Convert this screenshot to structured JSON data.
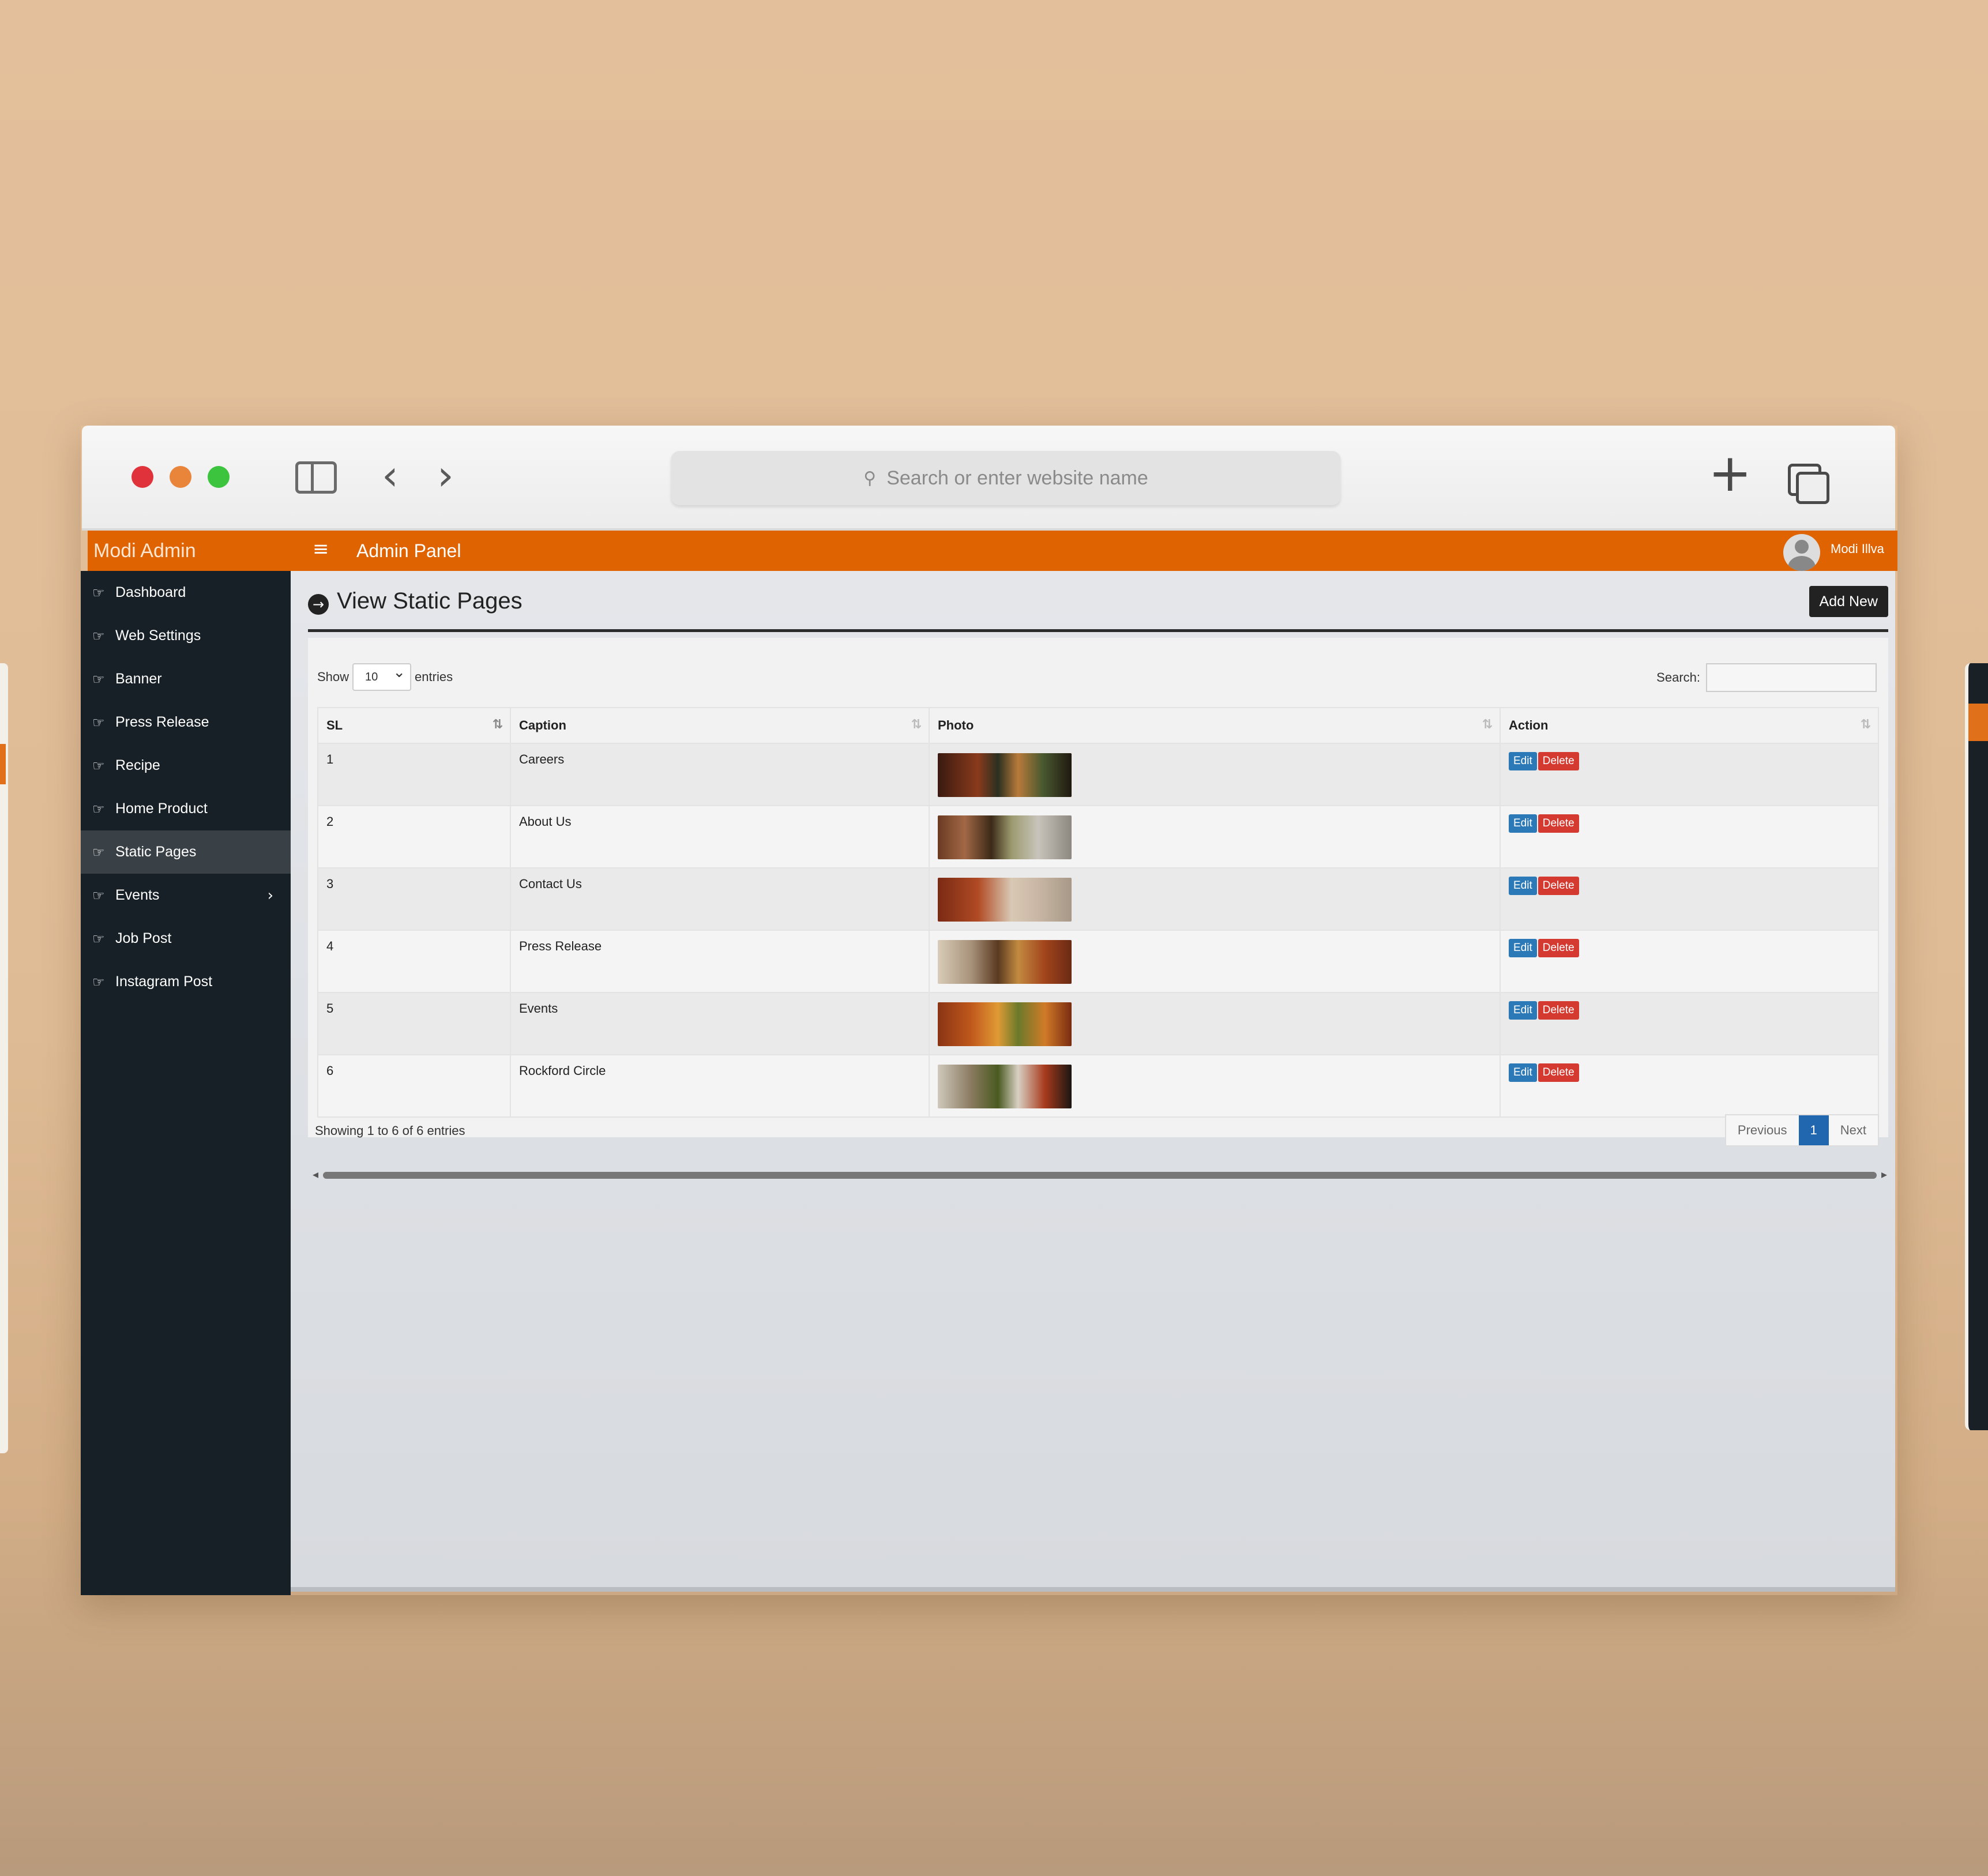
{
  "browser": {
    "address_placeholder": "Search or enter website name"
  },
  "app": {
    "brand": "Modi Admin",
    "panel_title": "Admin Panel",
    "user_name": "Modi Illva"
  },
  "sidebar": {
    "items": [
      {
        "label": "Dashboard"
      },
      {
        "label": "Web Settings"
      },
      {
        "label": "Banner"
      },
      {
        "label": "Press Release"
      },
      {
        "label": "Recipe"
      },
      {
        "label": "Home Product"
      },
      {
        "label": "Static Pages",
        "active": true
      },
      {
        "label": "Events",
        "has_submenu": true
      },
      {
        "label": "Job Post"
      },
      {
        "label": "Instagram Post"
      }
    ]
  },
  "page": {
    "title": "View Static Pages",
    "add_new_label": "Add New"
  },
  "table_controls": {
    "show_label": "Show",
    "entries_value": "10",
    "entries_label": "entries",
    "search_label": "Search:"
  },
  "table": {
    "headers": [
      "SL",
      "Caption",
      "Photo",
      "Action"
    ],
    "rows": [
      {
        "sl": "1",
        "caption": "Careers"
      },
      {
        "sl": "2",
        "caption": "About Us"
      },
      {
        "sl": "3",
        "caption": "Contact Us"
      },
      {
        "sl": "4",
        "caption": "Press Release"
      },
      {
        "sl": "5",
        "caption": "Events"
      },
      {
        "sl": "6",
        "caption": "Rockford Circle"
      }
    ],
    "edit_label": "Edit",
    "delete_label": "Delete"
  },
  "footer": {
    "info": "Showing 1 to 6 of 6 entries",
    "previous": "Previous",
    "current_page": "1",
    "next": "Next"
  },
  "colors": {
    "topbar": "#e06302",
    "sidebar": "#172026",
    "edit_button": "#2b79b6",
    "delete_button": "#d43a2f",
    "page_active": "#2067b0"
  }
}
